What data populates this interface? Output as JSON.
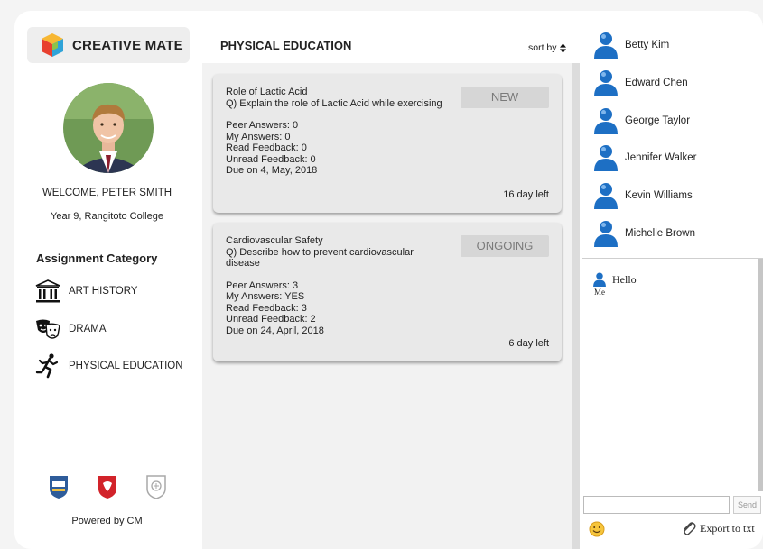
{
  "app": {
    "logo_text": "CREATIVE MATE"
  },
  "user": {
    "welcome": "WELCOME, PETER SMITH",
    "school": "Year 9, Rangitoto College"
  },
  "categories": {
    "title": "Assignment Category",
    "items": [
      {
        "label": "ART HISTORY",
        "icon": "museum-icon"
      },
      {
        "label": "DRAMA",
        "icon": "theatre-masks-icon"
      },
      {
        "label": "PHYSICAL EDUCATION",
        "icon": "runner-icon"
      }
    ]
  },
  "footer": {
    "powered": "Powered by CM"
  },
  "main": {
    "title": "PHYSICAL EDUCATION",
    "sort_label": "sort by",
    "assignments": [
      {
        "title": "Role of Lactic Acid",
        "question": "Q) Explain the role of Lactic Acid while exercising",
        "peer": "Peer Answers: 0",
        "mine": "My Answers: 0",
        "read": "Read Feedback: 0",
        "unread": "Unread Feedback: 0",
        "due": "Due on 4, May, 2018",
        "status": "NEW",
        "days_left": "16 day left"
      },
      {
        "title": "Cardiovascular Safety",
        "question": "Q) Describe how to prevent cardiovascular disease",
        "peer": "Peer Answers: 3",
        "mine": "My Answers: YES",
        "read": "Read Feedback: 3",
        "unread": "Unread Feedback: 2",
        "due": "Due on 24, April, 2018",
        "status": "ONGOING",
        "days_left": "6 day left"
      }
    ]
  },
  "contacts": [
    {
      "name": "Betty Kim"
    },
    {
      "name": "Edward Chen"
    },
    {
      "name": "George Taylor"
    },
    {
      "name": "Jennifer Walker"
    },
    {
      "name": "Kevin Williams"
    },
    {
      "name": "Michelle Brown"
    }
  ],
  "chat": {
    "messages": [
      {
        "sender": "Me",
        "text": "Hello"
      }
    ],
    "send_label": "Send",
    "input_value": "",
    "export_label": "Export to txt"
  },
  "colors": {
    "user_icon": "#1d6fc4",
    "panel": "#f2f2f2",
    "card": "#e9e9e9"
  }
}
